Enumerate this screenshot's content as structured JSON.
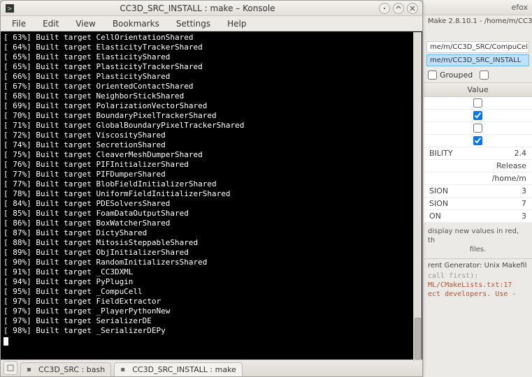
{
  "window": {
    "title": "CC3D_SRC_INSTALL : make – Konsole"
  },
  "menu": {
    "file": "File",
    "edit": "Edit",
    "view": "View",
    "bookmarks": "Bookmarks",
    "settings": "Settings",
    "help": "Help"
  },
  "terminal": {
    "lines": [
      "[ 63%] Built target CellOrientationShared",
      "[ 64%] Built target ElasticityTrackerShared",
      "[ 65%] Built target ElasticityShared",
      "[ 65%] Built target PlasticityTrackerShared",
      "[ 66%] Built target PlasticityShared",
      "[ 67%] Built target OrientedContactShared",
      "[ 68%] Built target NeighborStickShared",
      "[ 69%] Built target PolarizationVectorShared",
      "[ 70%] Built target BoundaryPixelTrackerShared",
      "[ 71%] Built target GlobalBoundaryPixelTrackerShared",
      "[ 72%] Built target ViscosityShared",
      "[ 74%] Built target SecretionShared",
      "[ 75%] Built target CleaverMeshDumperShared",
      "[ 76%] Built target PIFInitializerShared",
      "[ 77%] Built target PIFDumperShared",
      "[ 77%] Built target BlobFieldInitializerShared",
      "[ 78%] Built target UniformFieldInitializerShared",
      "[ 84%] Built target PDESolversShared",
      "[ 85%] Built target FoamDataOutputShared",
      "[ 86%] Built target BoxWatcherShared",
      "[ 87%] Built target DictyShared",
      "[ 88%] Built target MitosisSteppableShared",
      "[ 89%] Built target ObjInitializerShared",
      "[ 90%] Built target RandomInitializersShared",
      "[ 91%] Built target _CC3DXML",
      "[ 94%] Built target PyPlugin",
      "[ 95%] Built target _CompuCell",
      "[ 97%] Built target FieldExtractor",
      "[ 97%] Built target _PlayerPythonNew",
      "[ 97%] Built target SerializerDE",
      "[ 98%] Built target _SerializerDEPy"
    ]
  },
  "tabs": {
    "tab1": "CC3D_SRC : bash",
    "tab2": "CC3D_SRC_INSTALL : make"
  },
  "bg": {
    "app_hint": "efox",
    "subtitle": "Make 2.8.10.1 - /home/m/CC3",
    "path1": "me/m/CC3D_SRC/CompuCel",
    "path2": "me/m/CC3D_SRC_INSTALL",
    "grouped_label": "Grouped",
    "value_header": "Value",
    "checks": [
      false,
      true,
      false,
      true
    ],
    "rows": [
      {
        "k": "BILITY",
        "v": "2.4"
      },
      {
        "k": "",
        "v": "Release"
      },
      {
        "k": "",
        "v": "/home/m"
      },
      {
        "k": "SION",
        "v": "3"
      },
      {
        "k": "SION",
        "v": "7"
      },
      {
        "k": "ON",
        "v": "3"
      }
    ],
    "note1": "display new values in red, th",
    "note2": "files.",
    "gen": "rent Generator: Unix Makefil",
    "err1": "ML/CMakeLists.txt:17  ",
    "err2": "ect developers.  Use -"
  }
}
